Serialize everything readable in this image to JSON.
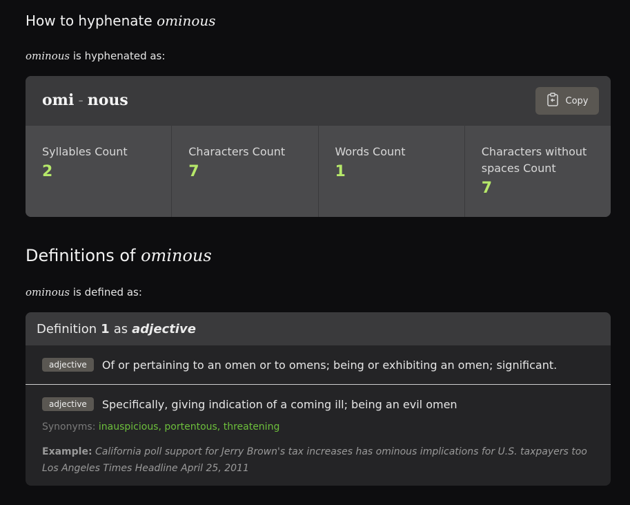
{
  "hyphenation": {
    "title_prefix": "How to hyphenate ",
    "word": "ominous",
    "lead_suffix": " is hyphenated as:",
    "syllables": [
      "omi",
      "nous"
    ],
    "separator": "-",
    "copy_label": "Copy",
    "stats": [
      {
        "label": "Syllables Count",
        "value": "2"
      },
      {
        "label": "Characters Count",
        "value": "7"
      },
      {
        "label": "Words Count",
        "value": "1"
      },
      {
        "label": "Characters without spaces Count",
        "value": "7"
      }
    ]
  },
  "definitions": {
    "title_prefix": "Definitions of ",
    "word": "ominous",
    "lead_suffix": " is defined as:",
    "header": {
      "prefix": "Definition",
      "number": "1",
      "middle": "as",
      "pos": "adjective"
    },
    "items": [
      {
        "pos": "adjective",
        "text": "Of or pertaining to an omen or to omens; being or exhibiting an omen; significant."
      },
      {
        "pos": "adjective",
        "text": "Specifically, giving indication of a coming ill; being an evil omen",
        "synonyms_label": "Synonyms:",
        "synonyms": [
          "inauspicious",
          "portentous",
          "threatening"
        ],
        "example_label": "Example:",
        "example": "California poll support for Jerry Brown's tax increases has ominous implications for U.S. taxpayers too Los Angeles Times Headline April 25, 2011"
      }
    ]
  },
  "colors": {
    "background": "#0d0d0f",
    "card": "#3a3a3c",
    "stat_value": "#b6e86a",
    "synonym_link": "#6dbf3c",
    "badge": "#5a5752"
  }
}
